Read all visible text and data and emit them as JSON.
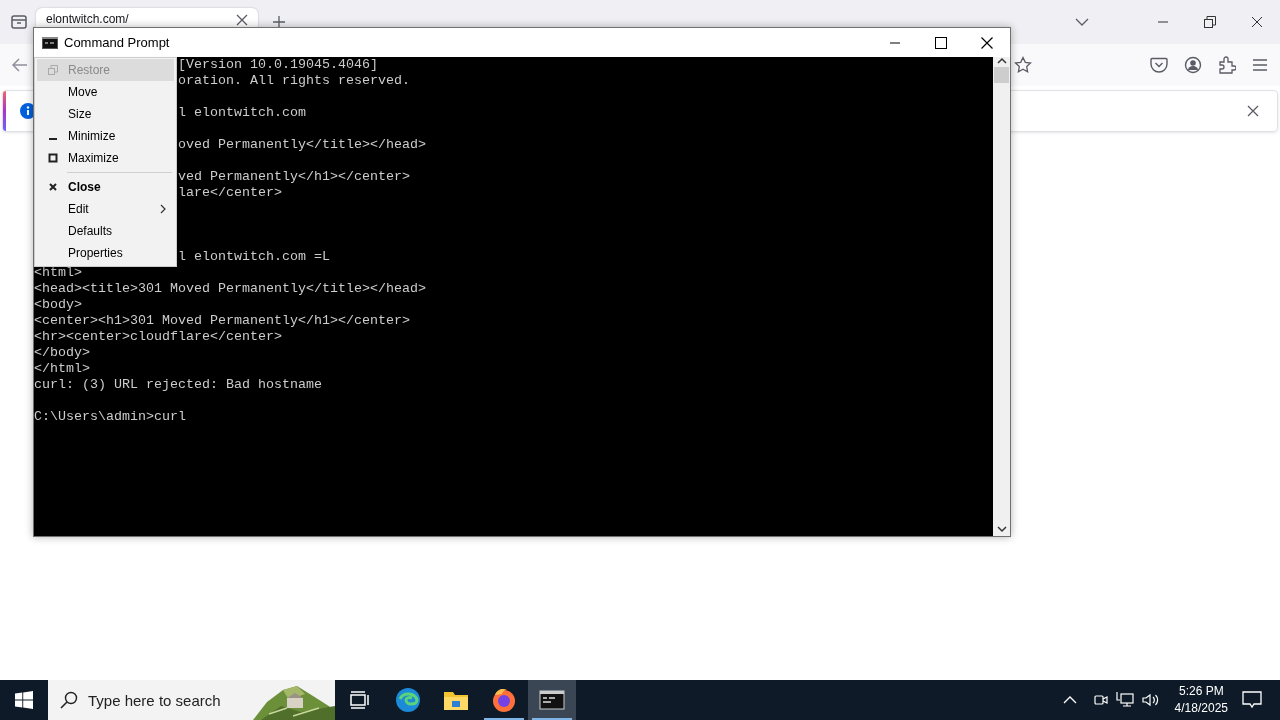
{
  "browser": {
    "tab": {
      "title": "elontwitch.com/"
    }
  },
  "console_window": {
    "title": "Command Prompt",
    "lines": [
      {
        "kind": "partial",
        "text": "[Version 10.0.19045.4046]"
      },
      {
        "kind": "partial",
        "text": "oration. All rights reserved."
      },
      {
        "kind": "blank"
      },
      {
        "kind": "partial",
        "text": "l elontwitch.com"
      },
      {
        "kind": "blank"
      },
      {
        "kind": "partial",
        "text": "oved Permanently</title></head>"
      },
      {
        "kind": "blank"
      },
      {
        "kind": "partial",
        "text": "ved Permanently</h1></center>"
      },
      {
        "kind": "partial",
        "text": "lare</center>"
      },
      {
        "kind": "blank"
      },
      {
        "kind": "blank"
      },
      {
        "kind": "blank"
      },
      {
        "kind": "partial",
        "text": "l elontwitch.com =L"
      },
      {
        "kind": "full",
        "text": "<html>"
      },
      {
        "kind": "full",
        "text": "<head><title>301 Moved Permanently</title></head>"
      },
      {
        "kind": "full",
        "text": "<body>"
      },
      {
        "kind": "full",
        "text": "<center><h1>301 Moved Permanently</h1></center>"
      },
      {
        "kind": "full",
        "text": "<hr><center>cloudflare</center>"
      },
      {
        "kind": "full",
        "text": "</body>"
      },
      {
        "kind": "full",
        "text": "</html>"
      },
      {
        "kind": "full",
        "text": "curl: (3) URL rejected: Bad hostname"
      },
      {
        "kind": "blank"
      },
      {
        "kind": "full",
        "text": "C:\\Users\\admin>curl"
      }
    ]
  },
  "window_menu": {
    "items": [
      {
        "kind": "restore",
        "label": "Restore",
        "disabled": true,
        "selected": true,
        "default": false
      },
      {
        "kind": "plain",
        "label": "Move",
        "disabled": false,
        "selected": false,
        "default": false
      },
      {
        "kind": "plain",
        "label": "Size",
        "disabled": false,
        "selected": false,
        "default": false
      },
      {
        "kind": "minimize",
        "label": "Minimize",
        "disabled": false,
        "selected": false,
        "default": false
      },
      {
        "kind": "maximize",
        "label": "Maximize",
        "disabled": false,
        "selected": false,
        "default": false
      },
      {
        "kind": "separator"
      },
      {
        "kind": "close",
        "label": "Close",
        "disabled": false,
        "selected": false,
        "default": true
      },
      {
        "kind": "submenu",
        "label": "Edit",
        "disabled": false,
        "selected": false,
        "default": false
      },
      {
        "kind": "plain",
        "label": "Defaults",
        "disabled": false,
        "selected": false,
        "default": false
      },
      {
        "kind": "plain",
        "label": "Properties",
        "disabled": false,
        "selected": false,
        "default": false
      }
    ]
  },
  "taskbar": {
    "search": {
      "placeholder": "Type here to search"
    },
    "apps": [
      {
        "kind": "edge",
        "running": false,
        "selected": false
      },
      {
        "kind": "explorer",
        "running": false,
        "selected": false
      },
      {
        "kind": "firefox",
        "running": true,
        "selected": false
      },
      {
        "kind": "terminal",
        "running": true,
        "selected": true
      }
    ],
    "clock": {
      "time": "5:26 PM",
      "date": "4/18/2025"
    }
  }
}
